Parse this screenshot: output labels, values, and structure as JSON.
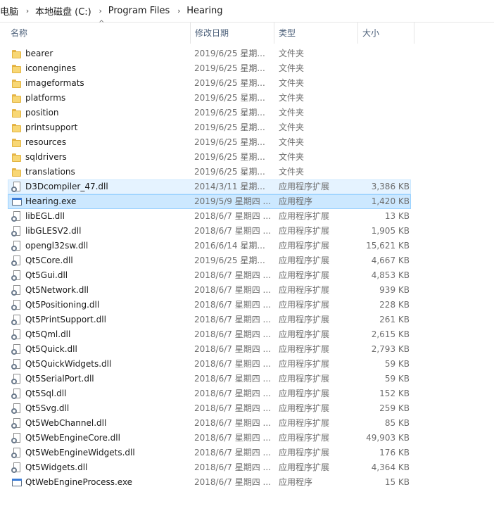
{
  "breadcrumb": [
    "电脑",
    "本地磁盘 (C:)",
    "Program Files",
    "Hearing"
  ],
  "columns": {
    "name": "名称",
    "date": "修改日期",
    "type": "类型",
    "size": "大小"
  },
  "files": [
    {
      "name": "bearer",
      "date": "2019/6/25 星期...",
      "type": "文件夹",
      "size": "",
      "kind": "folder"
    },
    {
      "name": "iconengines",
      "date": "2019/6/25 星期...",
      "type": "文件夹",
      "size": "",
      "kind": "folder"
    },
    {
      "name": "imageformats",
      "date": "2019/6/25 星期...",
      "type": "文件夹",
      "size": "",
      "kind": "folder"
    },
    {
      "name": "platforms",
      "date": "2019/6/25 星期...",
      "type": "文件夹",
      "size": "",
      "kind": "folder"
    },
    {
      "name": "position",
      "date": "2019/6/25 星期...",
      "type": "文件夹",
      "size": "",
      "kind": "folder"
    },
    {
      "name": "printsupport",
      "date": "2019/6/25 星期...",
      "type": "文件夹",
      "size": "",
      "kind": "folder"
    },
    {
      "name": "resources",
      "date": "2019/6/25 星期...",
      "type": "文件夹",
      "size": "",
      "kind": "folder"
    },
    {
      "name": "sqldrivers",
      "date": "2019/6/25 星期...",
      "type": "文件夹",
      "size": "",
      "kind": "folder"
    },
    {
      "name": "translations",
      "date": "2019/6/25 星期...",
      "type": "文件夹",
      "size": "",
      "kind": "folder"
    },
    {
      "name": "D3Dcompiler_47.dll",
      "date": "2014/3/11 星期...",
      "type": "应用程序扩展",
      "size": "3,386 KB",
      "kind": "dll",
      "state": "hover"
    },
    {
      "name": "Hearing.exe",
      "date": "2019/5/9 星期四 ...",
      "type": "应用程序",
      "size": "1,420 KB",
      "kind": "exe",
      "state": "selected"
    },
    {
      "name": "libEGL.dll",
      "date": "2018/6/7 星期四 ...",
      "type": "应用程序扩展",
      "size": "13 KB",
      "kind": "dll"
    },
    {
      "name": "libGLESV2.dll",
      "date": "2018/6/7 星期四 ...",
      "type": "应用程序扩展",
      "size": "1,905 KB",
      "kind": "dll"
    },
    {
      "name": "opengl32sw.dll",
      "date": "2016/6/14 星期...",
      "type": "应用程序扩展",
      "size": "15,621 KB",
      "kind": "dll"
    },
    {
      "name": "Qt5Core.dll",
      "date": "2019/6/25 星期...",
      "type": "应用程序扩展",
      "size": "4,667 KB",
      "kind": "dll"
    },
    {
      "name": "Qt5Gui.dll",
      "date": "2018/6/7 星期四 ...",
      "type": "应用程序扩展",
      "size": "4,853 KB",
      "kind": "dll"
    },
    {
      "name": "Qt5Network.dll",
      "date": "2018/6/7 星期四 ...",
      "type": "应用程序扩展",
      "size": "939 KB",
      "kind": "dll"
    },
    {
      "name": "Qt5Positioning.dll",
      "date": "2018/6/7 星期四 ...",
      "type": "应用程序扩展",
      "size": "228 KB",
      "kind": "dll"
    },
    {
      "name": "Qt5PrintSupport.dll",
      "date": "2018/6/7 星期四 ...",
      "type": "应用程序扩展",
      "size": "261 KB",
      "kind": "dll"
    },
    {
      "name": "Qt5Qml.dll",
      "date": "2018/6/7 星期四 ...",
      "type": "应用程序扩展",
      "size": "2,615 KB",
      "kind": "dll"
    },
    {
      "name": "Qt5Quick.dll",
      "date": "2018/6/7 星期四 ...",
      "type": "应用程序扩展",
      "size": "2,793 KB",
      "kind": "dll"
    },
    {
      "name": "Qt5QuickWidgets.dll",
      "date": "2018/6/7 星期四 ...",
      "type": "应用程序扩展",
      "size": "59 KB",
      "kind": "dll"
    },
    {
      "name": "Qt5SerialPort.dll",
      "date": "2018/6/7 星期四 ...",
      "type": "应用程序扩展",
      "size": "59 KB",
      "kind": "dll"
    },
    {
      "name": "Qt5Sql.dll",
      "date": "2018/6/7 星期四 ...",
      "type": "应用程序扩展",
      "size": "152 KB",
      "kind": "dll"
    },
    {
      "name": "Qt5Svg.dll",
      "date": "2018/6/7 星期四 ...",
      "type": "应用程序扩展",
      "size": "259 KB",
      "kind": "dll"
    },
    {
      "name": "Qt5WebChannel.dll",
      "date": "2018/6/7 星期四 ...",
      "type": "应用程序扩展",
      "size": "85 KB",
      "kind": "dll"
    },
    {
      "name": "Qt5WebEngineCore.dll",
      "date": "2018/6/7 星期四 ...",
      "type": "应用程序扩展",
      "size": "49,903 KB",
      "kind": "dll"
    },
    {
      "name": "Qt5WebEngineWidgets.dll",
      "date": "2018/6/7 星期四 ...",
      "type": "应用程序扩展",
      "size": "176 KB",
      "kind": "dll"
    },
    {
      "name": "Qt5Widgets.dll",
      "date": "2018/6/7 星期四 ...",
      "type": "应用程序扩展",
      "size": "4,364 KB",
      "kind": "dll"
    },
    {
      "name": "QtWebEngineProcess.exe",
      "date": "2018/6/7 星期四 ...",
      "type": "应用程序",
      "size": "15 KB",
      "kind": "exe"
    }
  ]
}
